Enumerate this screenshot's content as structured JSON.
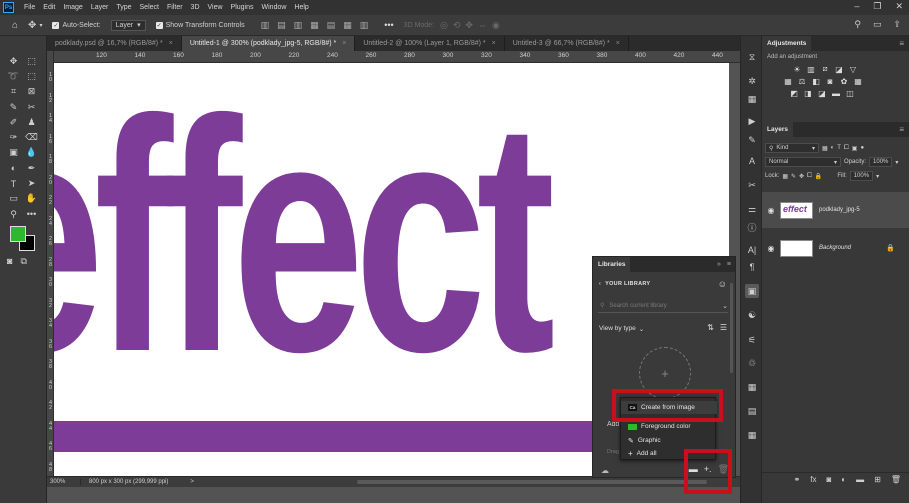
{
  "menu": [
    "File",
    "Edit",
    "Image",
    "Layer",
    "Type",
    "Select",
    "Filter",
    "3D",
    "View",
    "Plugins",
    "Window",
    "Help"
  ],
  "options_bar": {
    "auto_select_label": "Auto-Select:",
    "auto_select_value": "Layer",
    "show_transform_label": "Show Transform Controls",
    "mode_3d_label": "3D Mode:"
  },
  "tabs": [
    {
      "label": "podklady.psd @ 16,7% (RGB/8#) *",
      "active": false
    },
    {
      "label": "Untitled-1 @ 300% (podklady_jpg-5, RGB/8#) *",
      "active": true
    },
    {
      "label": "Untitled-2 @ 100% (Layer 1, RGB/8#) *",
      "active": false
    },
    {
      "label": "Untitled-3 @ 66,7% (RGB/8#) *",
      "active": false
    }
  ],
  "ruler_h": [
    "120",
    "140",
    "160",
    "180",
    "200",
    "220",
    "240",
    "260",
    "280",
    "300",
    "320",
    "340",
    "360",
    "380",
    "400",
    "420",
    "440"
  ],
  "ruler_v": [
    "1 0",
    "1 2",
    "1 4",
    "1 6",
    "1 8",
    "2 0",
    "2 2",
    "2 4",
    "2 6",
    "2 8",
    "3 0",
    "3 2",
    "3 4",
    "3 6",
    "3 8",
    "4 0",
    "4 2",
    "4 4",
    "4 6",
    "4 8"
  ],
  "canvas": {
    "word": "effect",
    "text_color": "#7d3c98"
  },
  "status": {
    "zoom": "300%",
    "doc_info": "800 px x 300 px (299,999 ppi)",
    "arrow": ">"
  },
  "colors": {
    "foreground": "#2db82d",
    "background": "#000000",
    "highlight": "#c8101a"
  },
  "adjustments": {
    "title": "Adjustments",
    "subtitle": "Add an adjustment"
  },
  "layers": {
    "title": "Layers",
    "filter_kind": "Kind",
    "blend_mode": "Normal",
    "opacity_label": "Opacity:",
    "opacity_value": "100%",
    "lock_label": "Lock:",
    "fill_label": "Fill:",
    "fill_value": "100%",
    "items": [
      {
        "name": "podklady_jpg-5",
        "thumb_text": "effect",
        "selected": true
      },
      {
        "name": "Background",
        "selected": false
      }
    ]
  },
  "libraries": {
    "title": "Libraries",
    "nav_label": "YOUR LIBRARY",
    "search_placeholder": "Search current library",
    "view_by": "View by type",
    "add_label": "Add",
    "drag_text": "Drag"
  },
  "context_menu": {
    "items": [
      "Create from image",
      "Foreground color",
      "Graphic",
      "Add all"
    ],
    "ca_badge": "Ca"
  }
}
